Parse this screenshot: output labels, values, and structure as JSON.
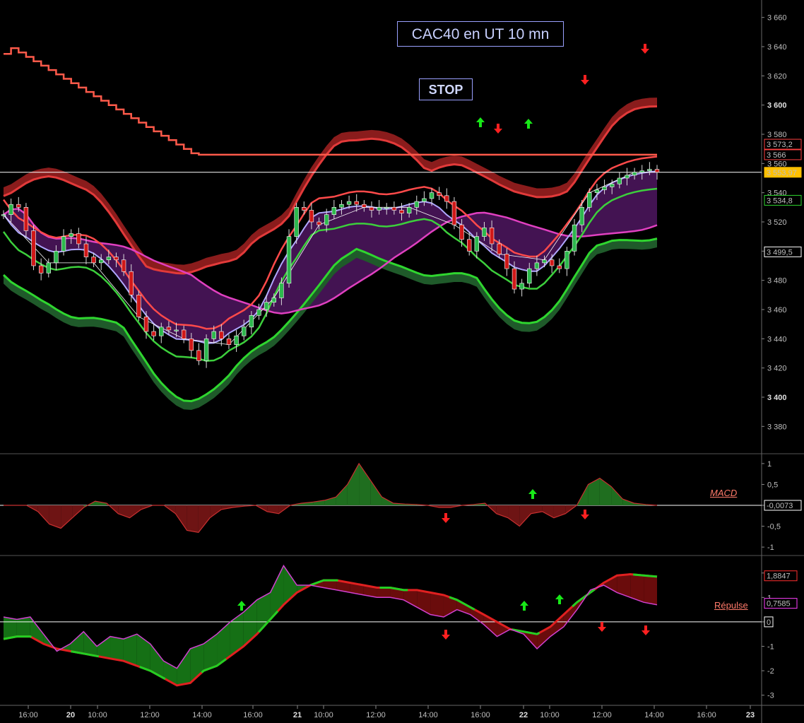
{
  "title": "CAC40 en UT 10 mn",
  "stop_label": "STOP",
  "colors": {
    "background": "#000000",
    "grid": "#1a1a1a",
    "bull_candle": "#2db84d",
    "bear_candle": "#d01818",
    "upper_band": "#e23a3a",
    "lower_band": "#2fd62f",
    "ma_pink": "#e040c0",
    "ma_white": "#ffffff",
    "ma_lavender": "#b0a8ff",
    "stop_line": "#ff5a4a",
    "arrow_up": "#18e818",
    "arrow_down": "#ff2020"
  },
  "chart_data": [
    {
      "type": "candlestick",
      "title": "CAC40 en UT 10 mn",
      "ylim": [
        3370,
        3670
      ],
      "y_ticks": [
        "3 660",
        "3 640",
        "3 620",
        "3 600",
        "3 580",
        "3 560",
        "3 540",
        "3 520",
        "3 500",
        "3 480",
        "3 460",
        "3 440",
        "3 420",
        "3 400",
        "3 380"
      ],
      "y_ticks_bold": [
        "3 600",
        "3 500",
        "3 400"
      ],
      "value_labels": [
        {
          "text": "3 573,2",
          "value": 3573.2,
          "color": "#ff4040"
        },
        {
          "text": "3 566",
          "value": 3566,
          "color": "#ff4040"
        },
        {
          "text": "3 553,97",
          "value": 3553.97,
          "color": "#ffc000"
        },
        {
          "text": "3 534,8",
          "value": 3534.8,
          "color": "#2fd62f"
        },
        {
          "text": "3 499,5",
          "value": 3499.5,
          "color": "#ffffff"
        }
      ],
      "horizontal_line": 3553.97,
      "close_series": [
        3525,
        3532,
        3530,
        3514,
        3490,
        3485,
        3492,
        3500,
        3510,
        3512,
        3505,
        3496,
        3492,
        3494,
        3496,
        3494,
        3486,
        3470,
        3455,
        3445,
        3442,
        3448,
        3446,
        3446,
        3440,
        3432,
        3425,
        3440,
        3445,
        3440,
        3436,
        3442,
        3448,
        3456,
        3460,
        3465,
        3468,
        3478,
        3510,
        3530,
        3528,
        3520,
        3518,
        3525,
        3530,
        3532,
        3534,
        3532,
        3530,
        3528,
        3530,
        3530,
        3528,
        3526,
        3530,
        3534,
        3536,
        3540,
        3538,
        3534,
        3518,
        3508,
        3500,
        3510,
        3516,
        3505,
        3498,
        3488,
        3474,
        3478,
        3488,
        3492,
        3494,
        3490,
        3488,
        3500,
        3518,
        3530,
        3540,
        3542,
        3544,
        3546,
        3550,
        3552,
        3554,
        3555,
        3556,
        3554
      ]
    },
    {
      "type": "area",
      "name": "MACD",
      "ylim": [
        -1.1,
        1.1
      ],
      "y_ticks": [
        "1",
        "0,5",
        "0",
        "-0,5",
        "-1"
      ],
      "value_label": "-0,0073",
      "values": [
        0,
        0,
        0,
        -0.15,
        -0.45,
        -0.55,
        -0.3,
        -0.05,
        0.1,
        0.05,
        -0.2,
        -0.3,
        -0.1,
        0,
        0,
        -0.2,
        -0.6,
        -0.65,
        -0.3,
        -0.1,
        -0.05,
        -0.02,
        0,
        -0.15,
        -0.2,
        0,
        0.05,
        0.08,
        0.12,
        0.2,
        0.5,
        1.0,
        0.6,
        0.2,
        0.05,
        0.03,
        0.02,
        0,
        -0.05,
        -0.05,
        0,
        0.02,
        0.05,
        -0.2,
        -0.3,
        -0.5,
        -0.2,
        -0.15,
        -0.3,
        -0.2,
        0,
        0.5,
        0.65,
        0.45,
        0.15,
        0.05,
        0.02,
        0
      ]
    },
    {
      "type": "area",
      "name": "Répulse",
      "ylim": [
        -3.3,
        2.6
      ],
      "y_ticks": [
        "2",
        "1",
        "0",
        "-1",
        "-2",
        "-3"
      ],
      "value_labels": [
        {
          "text": "1,8847",
          "value": 1.8847,
          "color": "#ff3030"
        },
        {
          "text": "0,7585",
          "value": 0.7585,
          "color": "#ff40ff"
        },
        {
          "text": "0",
          "value": 0,
          "color": "#ffffff"
        }
      ],
      "fast_values": [
        0.2,
        0.1,
        0.2,
        -0.5,
        -1.2,
        -0.9,
        -0.4,
        -1.0,
        -0.6,
        -0.7,
        -0.5,
        -0.9,
        -1.6,
        -1.9,
        -1.1,
        -0.9,
        -0.5,
        0,
        0.4,
        0.9,
        1.2,
        2.3,
        1.5,
        1.5,
        1.4,
        1.3,
        1.2,
        1.1,
        1.0,
        1.0,
        0.9,
        0.6,
        0.3,
        0.2,
        0.5,
        0.3,
        -0.1,
        -0.6,
        -0.3,
        -0.5,
        -1.1,
        -0.6,
        -0.2,
        0.5,
        1.3,
        1.5,
        1.2,
        1.0,
        0.8,
        0.7
      ],
      "slow_values": [
        -0.7,
        -0.6,
        -0.6,
        -0.9,
        -1.1,
        -1.2,
        -1.3,
        -1.4,
        -1.5,
        -1.6,
        -1.8,
        -2.0,
        -2.3,
        -2.6,
        -2.5,
        -2.0,
        -1.8,
        -1.4,
        -1.0,
        -0.5,
        0.1,
        0.7,
        1.2,
        1.5,
        1.7,
        1.7,
        1.6,
        1.5,
        1.4,
        1.4,
        1.3,
        1.3,
        1.2,
        1.1,
        0.9,
        0.6,
        0.3,
        0,
        -0.3,
        -0.4,
        -0.5,
        -0.2,
        0.3,
        0.8,
        1.2,
        1.6,
        1.9,
        1.95,
        1.9,
        1.85
      ]
    }
  ],
  "x_axis": {
    "labels": [
      {
        "text": "16:00",
        "bold": false
      },
      {
        "text": "20",
        "bold": true
      },
      {
        "text": "10:00",
        "bold": false
      },
      {
        "text": "12:00",
        "bold": false
      },
      {
        "text": "14:00",
        "bold": false
      },
      {
        "text": "16:00",
        "bold": false
      },
      {
        "text": "21",
        "bold": true
      },
      {
        "text": "10:00",
        "bold": false
      },
      {
        "text": "12:00",
        "bold": false
      },
      {
        "text": "14:00",
        "bold": false
      },
      {
        "text": "16:00",
        "bold": false
      },
      {
        "text": "22",
        "bold": true
      },
      {
        "text": "10:00",
        "bold": false
      },
      {
        "text": "12:00",
        "bold": false
      },
      {
        "text": "14:00",
        "bold": false
      },
      {
        "text": "16:00",
        "bold": false
      },
      {
        "text": "23",
        "bold": true
      }
    ]
  },
  "indicator_labels": {
    "macd": "MACD",
    "repulse": "Répulse"
  },
  "signals": {
    "price": [
      "up",
      "down",
      "up",
      "down",
      "down"
    ],
    "macd": [
      "down",
      "up",
      "down"
    ],
    "repulse": [
      "up",
      "down",
      "up",
      "up",
      "down",
      "down"
    ]
  }
}
